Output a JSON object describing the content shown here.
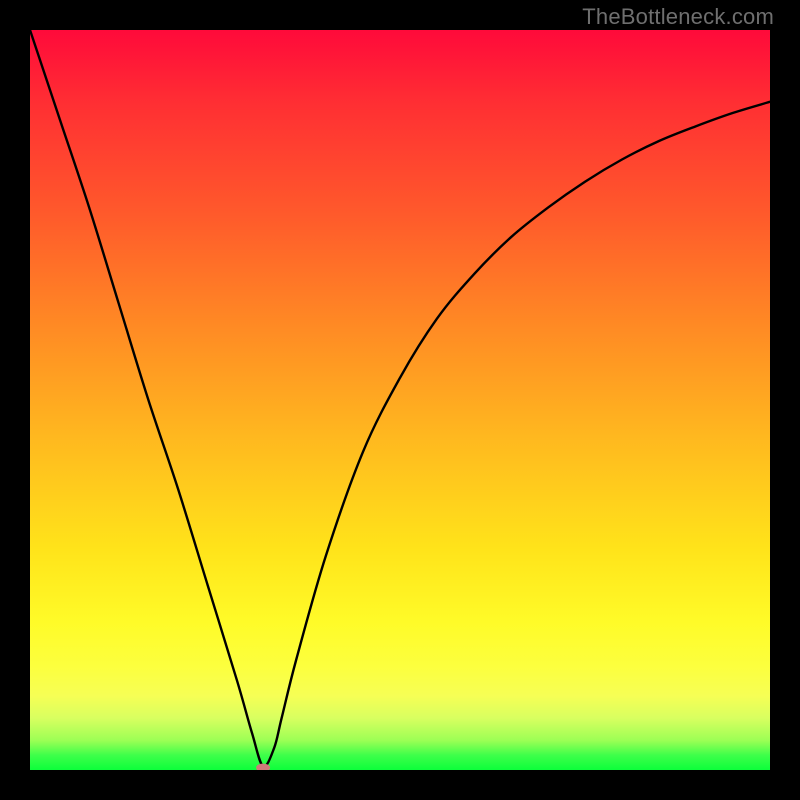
{
  "watermark": "TheBottleneck.com",
  "chart_data": {
    "type": "line",
    "title": "",
    "xlabel": "",
    "ylabel": "",
    "xlim": [
      0,
      100
    ],
    "ylim": [
      0,
      100
    ],
    "background_gradient": {
      "orientation": "vertical",
      "stops": [
        {
          "pos": 0.0,
          "color": "#ff0a3a"
        },
        {
          "pos": 0.4,
          "color": "#ff8a24"
        },
        {
          "pos": 0.7,
          "color": "#ffe31a"
        },
        {
          "pos": 0.9,
          "color": "#f6ff55"
        },
        {
          "pos": 1.0,
          "color": "#0cff3b"
        }
      ]
    },
    "series": [
      {
        "name": "bottleneck-curve",
        "color": "#000000",
        "x": [
          0,
          4,
          8,
          12,
          16,
          20,
          24,
          28,
          30,
          31.5,
          33,
          34,
          36,
          40,
          45,
          50,
          55,
          60,
          65,
          70,
          75,
          80,
          85,
          90,
          95,
          100
        ],
        "y": [
          100,
          88,
          76,
          63,
          50,
          38,
          25,
          12,
          5,
          0.5,
          3,
          7,
          15,
          29,
          43,
          53,
          61,
          67,
          72,
          76,
          79.5,
          82.5,
          85,
          87,
          88.8,
          90.3
        ]
      }
    ],
    "marker": {
      "name": "optimum-point",
      "x": 31.5,
      "y": 0.3,
      "color": "#cf7a7a",
      "rx": 7,
      "ry": 4.2
    }
  }
}
